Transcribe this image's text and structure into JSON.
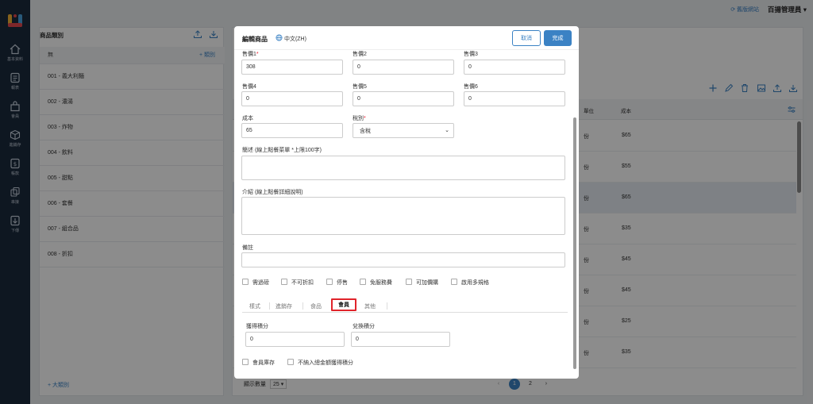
{
  "nav": {
    "items": [
      {
        "label": "基本資料",
        "icon": "home-icon"
      },
      {
        "label": "報表",
        "icon": "report-icon"
      },
      {
        "label": "會員",
        "icon": "member-icon"
      },
      {
        "label": "進銷存",
        "icon": "box-icon"
      },
      {
        "label": "帳款",
        "icon": "dollar-icon"
      },
      {
        "label": "串接",
        "icon": "link-icon"
      },
      {
        "label": "下傳",
        "icon": "download-icon"
      }
    ]
  },
  "topbar": {
    "switch_label": "舊版網站",
    "admin_label": "百揚管理員"
  },
  "categories": {
    "title": "商品類別",
    "head_label": "無",
    "add_label": "類別",
    "items": [
      "001 - 義大利麵",
      "002 - 濃湯",
      "003 - 炸物",
      "004 - 飲料",
      "005 - 甜點",
      "006 - 套餐",
      "007 - 組合品",
      "008 - 折扣"
    ],
    "footer_label": "大類別"
  },
  "products": {
    "col_unit": "單位",
    "col_cost": "成本",
    "rows": [
      {
        "unit": "份",
        "cost": "$65"
      },
      {
        "unit": "份",
        "cost": "$55"
      },
      {
        "unit": "份",
        "cost": "$65"
      },
      {
        "unit": "份",
        "cost": "$35"
      },
      {
        "unit": "份",
        "cost": "$45"
      },
      {
        "unit": "份",
        "cost": "$45"
      },
      {
        "unit": "份",
        "cost": "$25"
      },
      {
        "unit": "份",
        "cost": "$35"
      }
    ],
    "page_size_label": "顯示數量",
    "page_size": "25",
    "pages": [
      "1",
      "2"
    ]
  },
  "modal": {
    "title": "編輯商品",
    "lang": "中文(ZH)",
    "cancel_label": "取消",
    "done_label": "完成",
    "prices": [
      {
        "label": "售價1",
        "value": "308",
        "required": true
      },
      {
        "label": "售價2",
        "value": "0"
      },
      {
        "label": "售價3",
        "value": "0"
      },
      {
        "label": "售價4",
        "value": "0"
      },
      {
        "label": "售價5",
        "value": "0"
      },
      {
        "label": "售價6",
        "value": "0"
      }
    ],
    "cost_label": "成本",
    "cost_value": "65",
    "tax_label": "稅別",
    "tax_value": "含稅",
    "summary_label": "簡述 (線上點餐菜單 *上限100字)",
    "intro_label": "介紹 (線上點餐詳細說明)",
    "note_label": "備註",
    "checks": [
      "需過磅",
      "不可折扣",
      "停售",
      "免服務費",
      "可加價購",
      "啟用多規格"
    ],
    "tabs": [
      "樣式",
      "進銷存",
      "食品",
      "會員",
      "其他"
    ],
    "active_tab": "會員",
    "points_label": "獲得積分",
    "points_value": "0",
    "redeem_label": "兌換積分",
    "redeem_value": "0",
    "member_stock_label": "會員庫存",
    "exclude_label": "不納入總金額獲得積分"
  }
}
